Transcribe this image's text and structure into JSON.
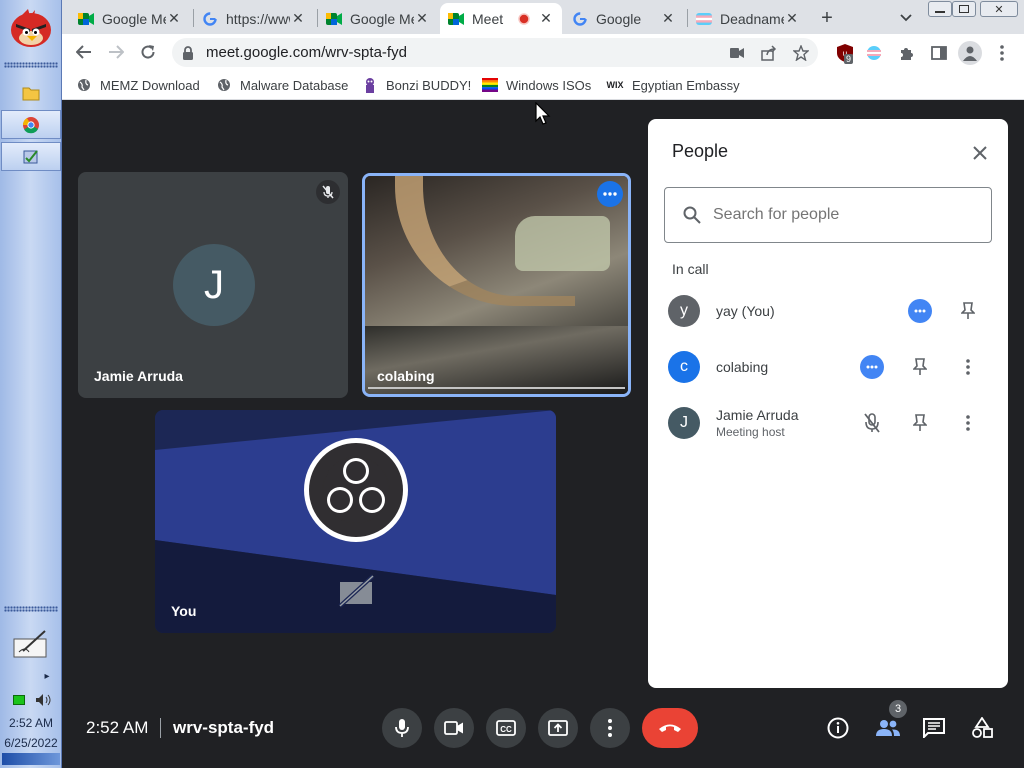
{
  "taskbar": {
    "tray_time": "2:52 AM",
    "tray_date": "6/25/2022"
  },
  "tabs": [
    {
      "title": "Google Meet",
      "icon": "meet-icon"
    },
    {
      "title": "https://www.google.com",
      "icon": "google-g-icon"
    },
    {
      "title": "Google Meet",
      "icon": "meet-icon"
    },
    {
      "title": "Meet",
      "icon": "meet-icon",
      "active": true,
      "recording": true
    },
    {
      "title": "Google",
      "icon": "google-g-icon"
    },
    {
      "title": "Deadname",
      "icon": "trans-flag-icon"
    }
  ],
  "toolbar": {
    "url": "meet.google.com/wrv-spta-fyd",
    "extension_badge": "9"
  },
  "bookmarks": [
    {
      "label": "MEMZ Download",
      "icon": "globe-icon"
    },
    {
      "label": "Malware Database",
      "icon": "globe-icon"
    },
    {
      "label": "Bonzi BUDDY!",
      "icon": "bonzi-icon"
    },
    {
      "label": "Windows ISOs",
      "icon": "rainbow-icon"
    },
    {
      "label": "Egyptian Embassy",
      "icon": "wix-icon"
    }
  ],
  "tiles": {
    "jamie": {
      "name": "Jamie Arruda",
      "initial": "J"
    },
    "colabing": {
      "name": "colabing"
    },
    "you": {
      "name": "You"
    }
  },
  "people_panel": {
    "title": "People",
    "search_placeholder": "Search for people",
    "section_label": "In call",
    "people": [
      {
        "initial": "y",
        "name": "yay (You)",
        "sub": "",
        "color": "#5f6368"
      },
      {
        "initial": "c",
        "name": "colabing",
        "sub": "",
        "color": "#1a73e8"
      },
      {
        "initial": "J",
        "name": "Jamie Arruda",
        "sub": "Meeting host",
        "color": "#455a64"
      }
    ]
  },
  "bottom_bar": {
    "time": "2:52 AM",
    "meeting_code": "wrv-spta-fyd",
    "people_count": "3"
  },
  "colors": {
    "accent": "#1a73e8",
    "end_call": "#ea4335",
    "meet_bg": "#202124"
  }
}
